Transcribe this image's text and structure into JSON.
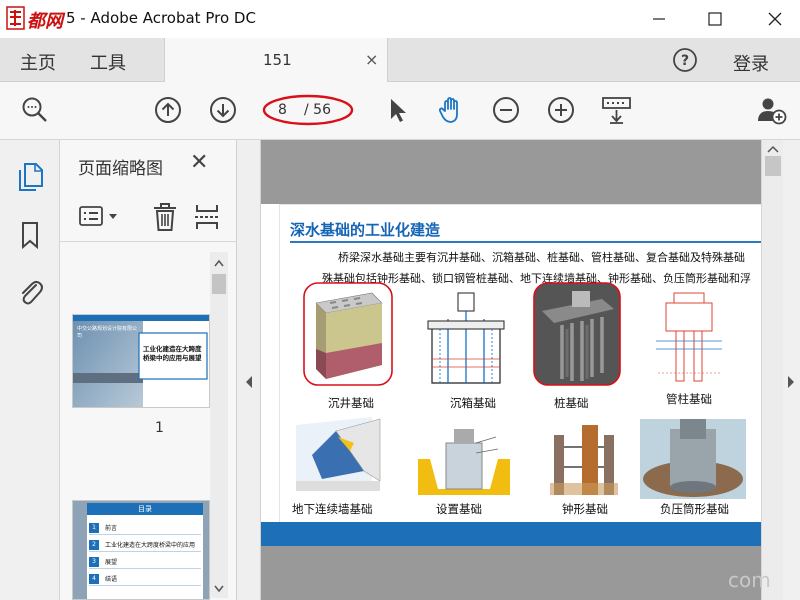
{
  "window": {
    "title": "5 - Adobe Acrobat Pro DC",
    "logo_text": "都网"
  },
  "menubar": {
    "home": "主页",
    "tools": "工具",
    "tab_label": "151",
    "tab_close": "×",
    "login": "登录"
  },
  "toolbar": {
    "current_page": "8",
    "total_pages": "/ 56"
  },
  "thumbs": {
    "title": "页面缩略图",
    "close": "✕",
    "page1_number": "1",
    "page1_heading": "工业化建造在大跨度桥梁中的应用与展望",
    "page1_header": "中交公路规划设计院有限公司",
    "page2_heading": "目录",
    "page2_items": [
      {
        "num": "1",
        "text": "前言"
      },
      {
        "num": "2",
        "text": "工业化建造在大跨度桥梁中的应用"
      },
      {
        "num": "3",
        "text": "展望"
      },
      {
        "num": "4",
        "text": "结语"
      }
    ]
  },
  "slide": {
    "title": "深水基础的工业化建造",
    "line1": "桥梁深水基础主要有沉井基础、沉箱基础、桩基础、管柱基础、复合基础及特殊基础",
    "line2": "殊基础包括钟形基础、锁口钢管桩基础、地下连续墙基础、钟形基础、负压筒形基础和浮",
    "captions": {
      "caisson": "沉井基础",
      "pneumatic": "沉箱基础",
      "pile": "桩基础",
      "pipe_pile": "管柱基础",
      "diaphragm": "地下连续墙基础",
      "placed": "设置基础",
      "bell": "钟形基础",
      "suction": "负压筒形基础"
    }
  },
  "watermark": "com",
  "colors": {
    "accent": "#1565b5",
    "highlight_red": "#d9101a",
    "hand_blue": "#1c76c4"
  },
  "icons": {
    "zoom": "magnifier-icon",
    "prev": "arrow-up-circle-icon",
    "next": "arrow-down-circle-icon",
    "select": "pointer-arrow-icon",
    "hand": "hand-icon",
    "zoom_out": "minus-circle-icon",
    "zoom_in": "plus-circle-icon",
    "keyboard": "keyboard-icon",
    "add_user": "add-user-icon"
  }
}
